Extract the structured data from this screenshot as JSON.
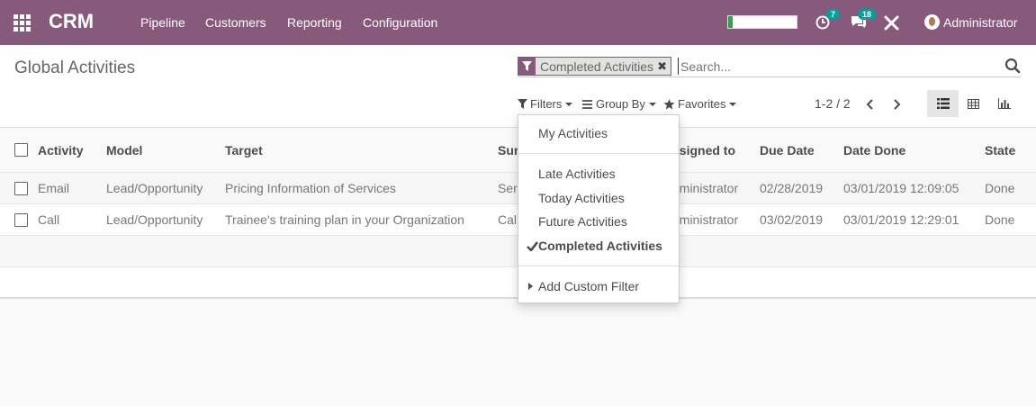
{
  "navbar": {
    "brand": "CRM",
    "menu": [
      "Pipeline",
      "Customers",
      "Reporting",
      "Configuration"
    ],
    "activity_count": "7",
    "message_count": "18",
    "user_name": "Administrator",
    "progress_fraction": 0.06,
    "colors": {
      "bar": "#875a7b",
      "badge": "#00a09d",
      "progress": "#28a745"
    }
  },
  "control": {
    "title": "Global Activities",
    "facet": "Completed Activities",
    "search_placeholder": "Search...",
    "filters_label": "Filters",
    "group_by_label": "Group By",
    "favorites_label": "Favorites",
    "pager": "1-2 / 2"
  },
  "table": {
    "columns": [
      "Activity",
      "Model",
      "Target",
      "Sur",
      "ssigned to",
      "Due Date",
      "Date Done",
      "State"
    ],
    "rows": [
      {
        "activity": "Email",
        "model": "Lead/Opportunity",
        "target": "Pricing Information of Services",
        "summary": "Ser",
        "assigned": "dministrator",
        "due": "02/28/2019",
        "done": "03/01/2019 12:09:05",
        "state": "Done"
      },
      {
        "activity": "Call",
        "model": "Lead/Opportunity",
        "target": "Trainee's training plan in your Organization",
        "summary": "Cal",
        "assigned": "dministrator",
        "due": "03/02/2019",
        "done": "03/01/2019 12:29:01",
        "state": "Done"
      }
    ]
  },
  "filters_menu": {
    "my_activities": "My Activities",
    "late": "Late Activities",
    "today": "Today Activities",
    "future": "Future Activities",
    "completed": "Completed Activities",
    "add_custom": "Add Custom Filter"
  }
}
